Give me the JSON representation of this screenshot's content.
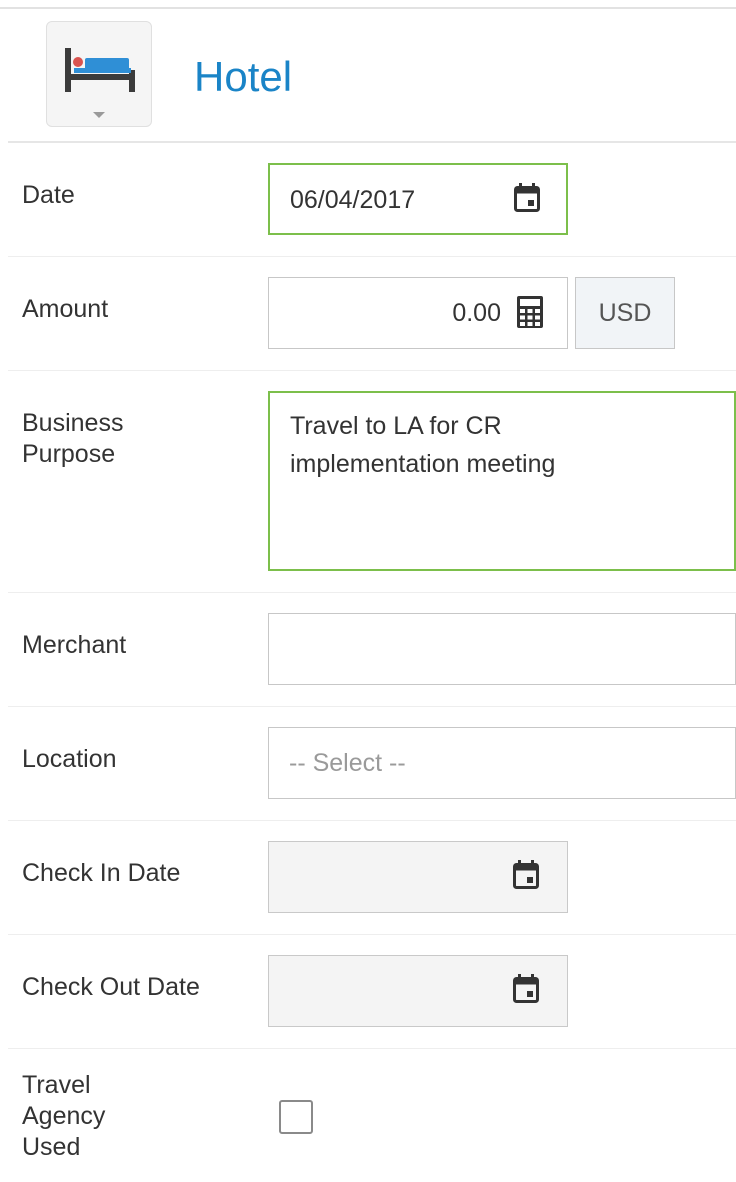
{
  "header": {
    "icon": "hotel-bed-icon",
    "title": "Hotel"
  },
  "fields": {
    "date": {
      "label": "Date",
      "value": "06/04/2017",
      "icon": "calendar-icon"
    },
    "amount": {
      "label": "Amount",
      "value": "0.00",
      "icon": "calculator-icon",
      "currency": "USD"
    },
    "business_purpose": {
      "label": "Business\nPurpose",
      "value": "Travel to LA for CR\nimplementation meeting"
    },
    "merchant": {
      "label": "Merchant",
      "value": ""
    },
    "location": {
      "label": "Location",
      "placeholder": "-- Select --"
    },
    "check_in": {
      "label": "Check In Date",
      "value": "",
      "icon": "calendar-icon"
    },
    "check_out": {
      "label": "Check Out Date",
      "value": "",
      "icon": "calendar-icon"
    },
    "travel_agency": {
      "label": "Travel\nAgency\nUsed",
      "checked": false
    }
  },
  "colors": {
    "title_blue": "#1a84c7",
    "valid_border": "#7cbf4b",
    "bed_blue": "#2f8fd6",
    "bed_dark": "#3b3b3b",
    "bed_red": "#d9534f"
  }
}
